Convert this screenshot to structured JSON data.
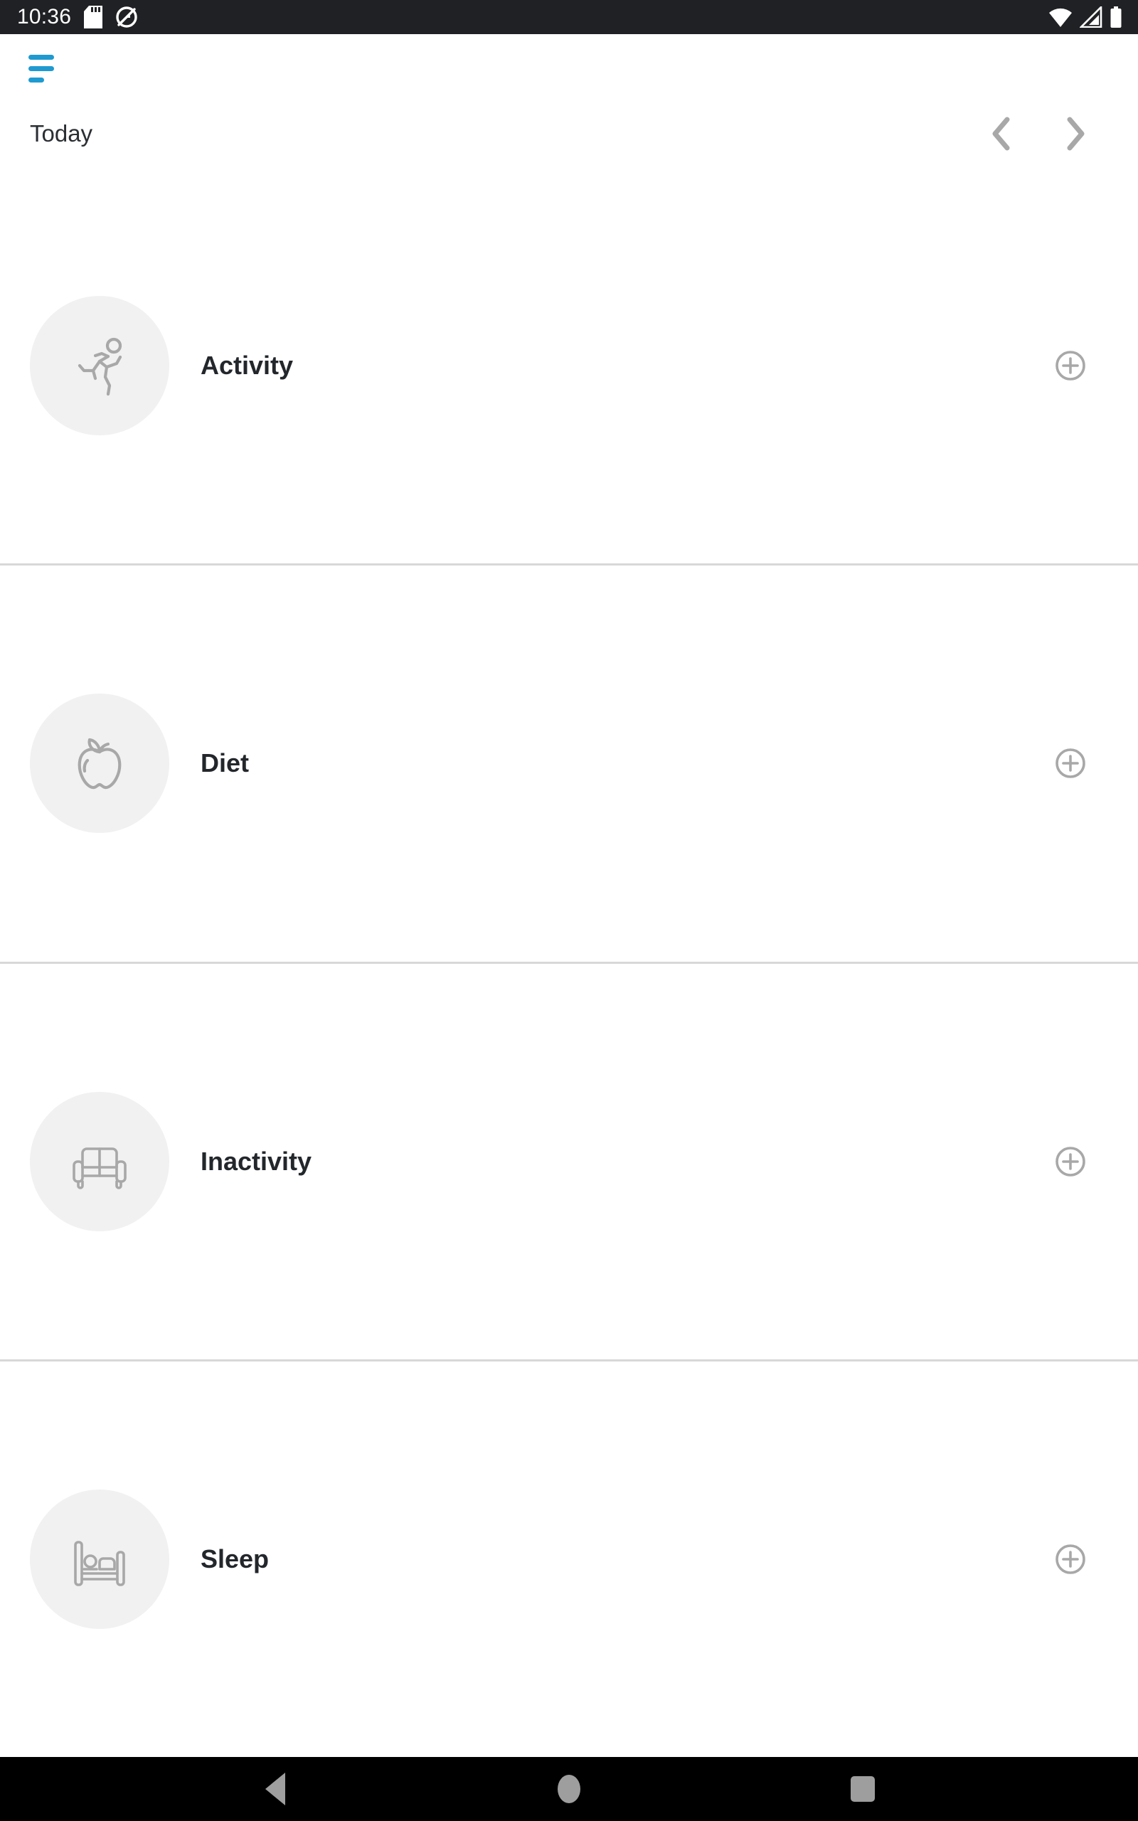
{
  "status_bar": {
    "time": "10:36",
    "left_icons": [
      "sd-card-icon",
      "do-not-disturb-icon"
    ],
    "right_icons": [
      "wifi-icon",
      "cellular-signal-icon",
      "battery-icon"
    ],
    "background_color": "#202124",
    "foreground_color": "#ffffff"
  },
  "app_bar": {
    "menu_icon": "hamburger-menu-icon",
    "menu_color": "#1f9ad0"
  },
  "date_nav": {
    "label": "Today",
    "prev_icon": "chevron-left-icon",
    "next_icon": "chevron-right-icon",
    "arrow_color": "#a8a8a8"
  },
  "categories": [
    {
      "label": "Activity",
      "icon": "running-person-icon",
      "add_icon": "plus-circle-icon"
    },
    {
      "label": "Diet",
      "icon": "apple-icon",
      "add_icon": "plus-circle-icon"
    },
    {
      "label": "Inactivity",
      "icon": "sofa-icon",
      "add_icon": "plus-circle-icon"
    },
    {
      "label": "Sleep",
      "icon": "bed-icon",
      "add_icon": "plus-circle-icon"
    }
  ],
  "nav_bar": {
    "back": "back-triangle-icon",
    "home": "home-circle-icon",
    "recents": "recents-square-icon",
    "background_color": "#000000",
    "icon_color": "#9e9e9e"
  },
  "theme": {
    "accent": "#1f9ad0",
    "icon_gray": "#a8a8a8",
    "circle_bg": "#f1f1f1",
    "text_dark": "#23272b",
    "divider": "#d8d8d8"
  }
}
